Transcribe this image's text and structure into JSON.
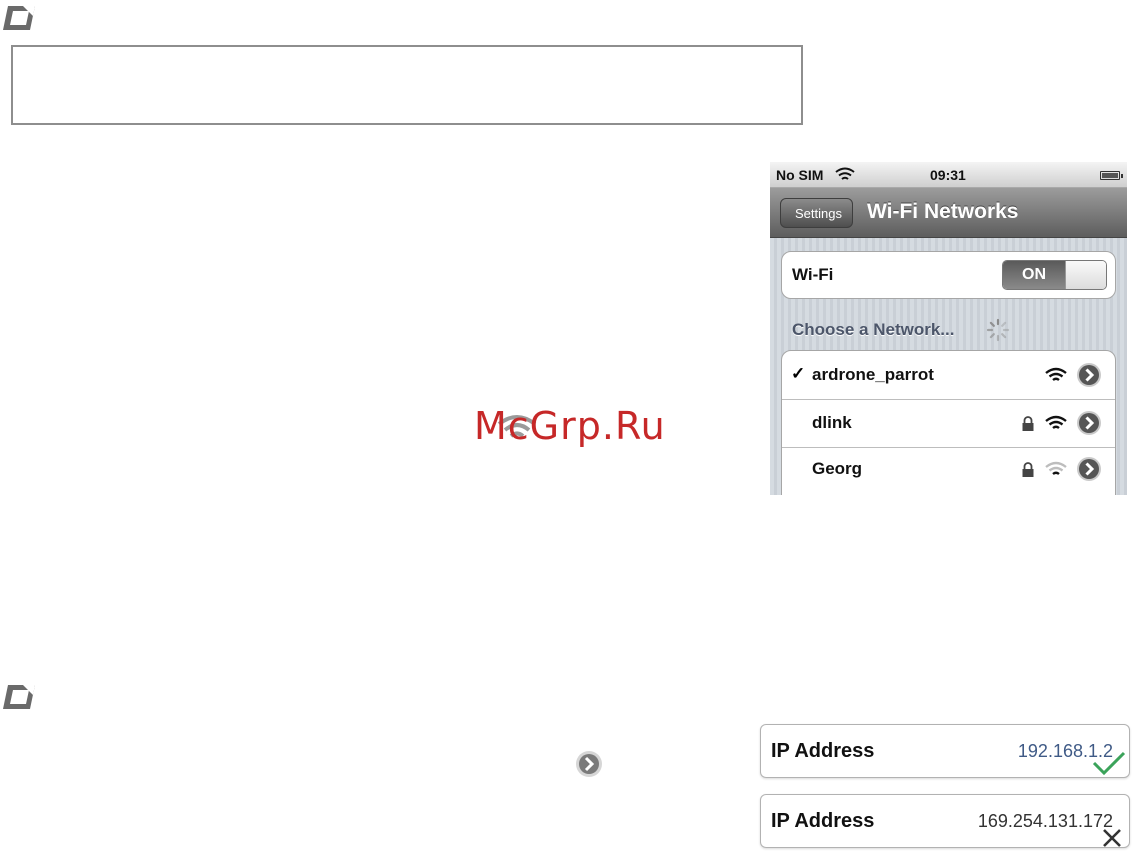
{
  "colors": {
    "ip_valid": "#3f5a86",
    "ip_invalid": "#333333",
    "check_mark": "#3ba35a",
    "watermark": "#c62828"
  },
  "watermark": {
    "text": "McGrp.Ru"
  },
  "phone": {
    "status_bar": {
      "carrier": "No SIM",
      "time": "09:31"
    },
    "nav": {
      "back_label": "Settings",
      "title": "Wi-Fi Networks"
    },
    "wifi_row": {
      "label": "Wi-Fi",
      "toggle_label": "ON"
    },
    "choose_network_label": "Choose a Network...",
    "networks": [
      {
        "name": "ardrone_parrot",
        "selected_mark": "✓",
        "locked": false,
        "signal": "strong"
      },
      {
        "name": "dlink",
        "selected_mark": "",
        "locked": true,
        "signal": "strong"
      },
      {
        "name": "Georg",
        "selected_mark": "",
        "locked": true,
        "signal": "weak"
      }
    ]
  },
  "ip_examples": [
    {
      "label": "IP Address",
      "value": "192.168.1.2",
      "status_icon": "check-icon"
    },
    {
      "label": "IP Address",
      "value": "169.254.131.172",
      "status_icon": "cross-icon"
    }
  ]
}
